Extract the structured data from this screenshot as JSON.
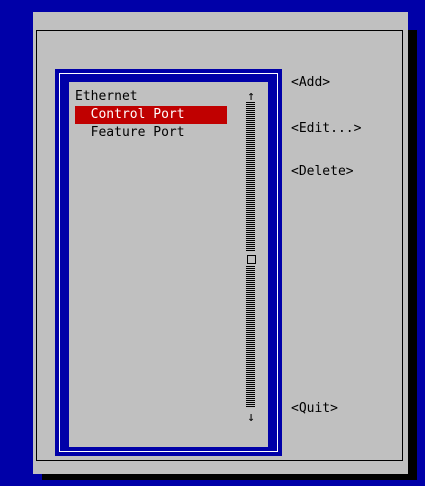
{
  "listbox": {
    "items": [
      {
        "label": "Ethernet",
        "selected": false
      },
      {
        "label": "  Control Port",
        "selected": true
      },
      {
        "label": "  Feature Port",
        "selected": false
      }
    ],
    "scroll_up_glyph": "↑",
    "scroll_down_glyph": "↓"
  },
  "buttons": {
    "add": "<Add>",
    "edit": "<Edit...>",
    "delete": "<Delete>",
    "quit": "<Quit>"
  },
  "colors": {
    "screen_bg": "#0000a8",
    "dialog_bg": "#c0c0c0",
    "selection_bg": "#c00000",
    "selection_fg": "#ffffff"
  }
}
